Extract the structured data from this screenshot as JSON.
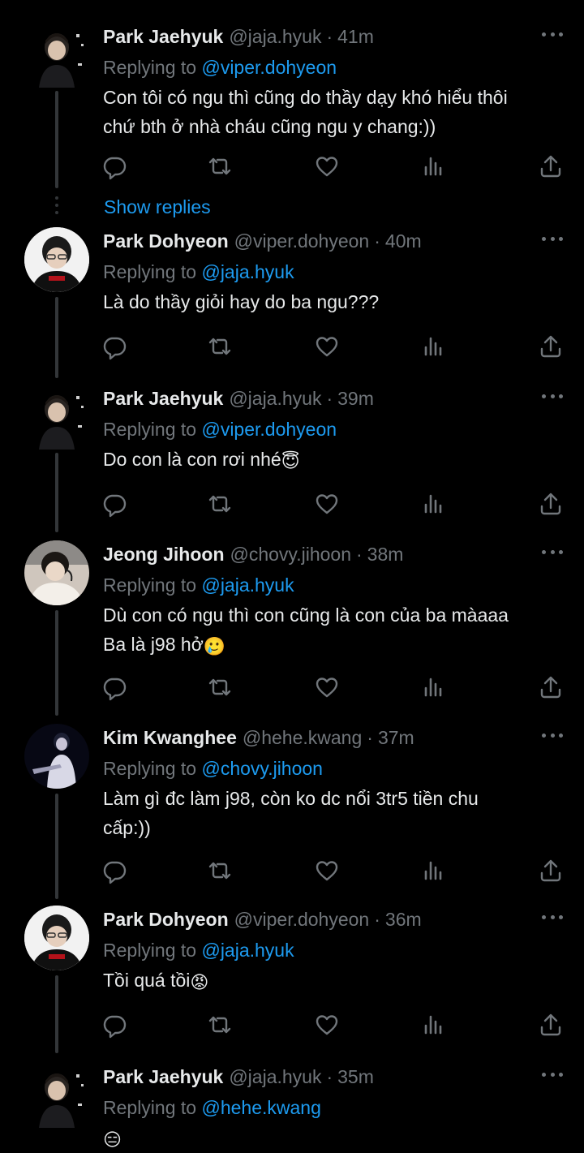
{
  "colors": {
    "background": "#000000",
    "text": "#e7e9ea",
    "muted": "#71767b",
    "link": "#1d9bf0",
    "thread_line": "#333639"
  },
  "replying_label": "Replying to",
  "show_replies": "Show replies",
  "action_icons": [
    "reply-icon",
    "retweet-icon",
    "like-icon",
    "views-icon",
    "share-icon"
  ],
  "tweets": [
    {
      "name": "Park Jaehyuk",
      "handle": "@jaja.hyuk",
      "time": "41m",
      "replying_to": "@viper.dohyeon",
      "lines": [
        "Con tôi có ngu thì cũng do thầy dạy khó hiểu thôi",
        "chứ bth ở nhà cháu cũng ngu y chang:))"
      ],
      "emoji": ""
    },
    {
      "name": "Park Dohyeon",
      "handle": "@viper.dohyeon",
      "time": "40m",
      "replying_to": "@jaja.hyuk",
      "lines": [
        "Là do thầy giỏi hay do ba ngu???"
      ],
      "emoji": ""
    },
    {
      "name": "Park Jaehyuk",
      "handle": "@jaja.hyuk",
      "time": "39m",
      "replying_to": "@viper.dohyeon",
      "lines": [
        "Do con là con rơi nhé"
      ],
      "emoji": "😇"
    },
    {
      "name": "Jeong Jihoon",
      "handle": "@chovy.jihoon",
      "time": "38m",
      "replying_to": "@jaja.hyuk",
      "lines": [
        "Dù con có ngu thì con cũng là con của ba màaaa",
        "Ba là j98 hở"
      ],
      "emoji": "🥲"
    },
    {
      "name": "Kim Kwanghee",
      "handle": "@hehe.kwang",
      "time": "37m",
      "replying_to": "@chovy.jihoon",
      "lines": [
        "Làm gì đc làm j98, còn ko dc nổi 3tr5 tiền chu",
        "cấp:))"
      ],
      "emoji": ""
    },
    {
      "name": "Park Dohyeon",
      "handle": "@viper.dohyeon",
      "time": "36m",
      "replying_to": "@jaja.hyuk",
      "lines": [
        "Tồi quá tồi"
      ],
      "emoji": "😡"
    },
    {
      "name": "Park Jaehyuk",
      "handle": "@jaja.hyuk",
      "time": "35m",
      "replying_to": "@hehe.kwang",
      "lines": [
        ""
      ],
      "emoji": "😑"
    }
  ]
}
